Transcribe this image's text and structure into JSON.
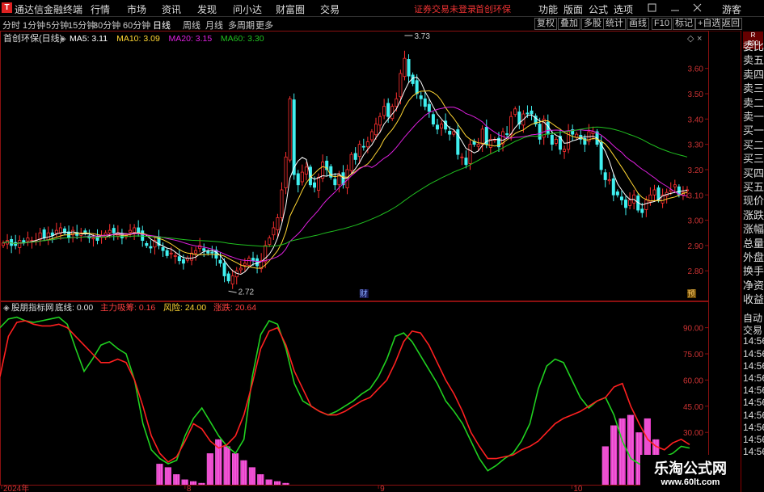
{
  "window": {
    "title": "通达信金融终端",
    "guest": "游客",
    "notice": "证券交易未登录",
    "stock_short": "首创环保"
  },
  "menu": [
    "行情",
    "市场",
    "资讯",
    "发现",
    "问小达",
    "财富圈",
    "交易"
  ],
  "menu_right": [
    "功能",
    "版面",
    "公式",
    "选项"
  ],
  "periods": [
    "分时",
    "1分钟",
    "5分钟",
    "15分钟",
    "30分钟",
    "60分钟",
    "日线",
    "周线",
    "月线",
    "多周期",
    "更多"
  ],
  "period_selected": "日线",
  "toolbar": [
    "复权",
    "叠加",
    "多股",
    "统计",
    "画线",
    "F10",
    "标记",
    "+自选",
    "返回"
  ],
  "right_panel": {
    "badge_top": "R",
    "badge_bottom": "500",
    "items": [
      "委比",
      "卖五",
      "卖四",
      "卖三",
      "卖二",
      "卖一",
      "买一",
      "买二",
      "买三",
      "买四",
      "买五",
      "现价",
      "涨跌",
      "涨幅",
      "总量",
      "外盘",
      "换手",
      "净资",
      "收益"
    ]
  },
  "right_panel_lower": [
    "自动",
    "交易",
    "14:56",
    "14:56",
    "14:56",
    "14:56",
    "14:56",
    "14:56",
    "14:56",
    "14:56",
    "14:56",
    "14:56"
  ],
  "watermark": {
    "line1": "乐淘公式网",
    "line2": "www.60lt.com"
  },
  "chart_data": [
    {
      "type": "candlestick",
      "title": "首创环保(日线)",
      "legend": [
        {
          "name": "MA5",
          "value": "3.11",
          "color": "#ffffff"
        },
        {
          "name": "MA10",
          "value": "3.09",
          "color": "#ffd633"
        },
        {
          "name": "MA20",
          "value": "3.15",
          "color": "#e020e0"
        },
        {
          "name": "MA60",
          "value": "3.30",
          "color": "#20c020"
        }
      ],
      "y_ticks": [
        "3.60",
        "3.50",
        "3.40",
        "3.30",
        "3.20",
        "3.10",
        "3.00",
        "2.90",
        "2.80"
      ],
      "ylim": [
        2.74,
        3.73
      ],
      "annotations": [
        {
          "text": "3.73",
          "index": 98,
          "value": 3.73
        },
        {
          "text": "2.72",
          "index": 55,
          "value": 2.72
        }
      ],
      "markers": [
        {
          "text": "财",
          "index": 88
        },
        {
          "text": "预",
          "index": 168
        }
      ],
      "close": [
        2.91,
        2.92,
        2.9,
        2.9,
        2.92,
        2.91,
        2.93,
        2.92,
        2.92,
        2.95,
        2.93,
        2.95,
        2.94,
        2.96,
        2.97,
        2.95,
        2.93,
        2.96,
        2.94,
        2.95,
        2.95,
        2.93,
        2.93,
        2.92,
        2.94,
        2.95,
        2.96,
        2.95,
        2.95,
        2.93,
        2.94,
        2.96,
        2.97,
        2.95,
        2.92,
        2.9,
        2.89,
        2.92,
        2.9,
        2.88,
        2.86,
        2.87,
        2.86,
        2.84,
        2.83,
        2.85,
        2.87,
        2.88,
        2.9,
        2.88,
        2.87,
        2.87,
        2.85,
        2.83,
        2.78,
        2.76,
        2.78,
        2.8,
        2.81,
        2.83,
        2.85,
        2.84,
        2.82,
        2.84,
        2.9,
        2.93,
        2.97,
        3.01,
        3.12,
        3.25,
        3.48,
        3.18,
        3.14,
        3.19,
        3.21,
        3.14,
        3.13,
        3.17,
        3.23,
        3.2,
        3.17,
        3.14,
        3.18,
        3.14,
        3.2,
        3.26,
        3.24,
        3.3,
        3.29,
        3.31,
        3.35,
        3.38,
        3.41,
        3.45,
        3.41,
        3.45,
        3.48,
        3.58,
        3.64,
        3.57,
        3.54,
        3.5,
        3.48,
        3.45,
        3.43,
        3.38,
        3.36,
        3.38,
        3.36,
        3.34,
        3.35,
        3.26,
        3.25,
        3.22,
        3.3,
        3.3,
        3.3,
        3.36,
        3.3,
        3.32,
        3.32,
        3.29,
        3.35,
        3.34,
        3.41,
        3.44,
        3.38,
        3.42,
        3.42,
        3.42,
        3.38,
        3.32,
        3.4,
        3.34,
        3.3,
        3.32,
        3.28,
        3.28,
        3.35,
        3.34,
        3.34,
        3.32,
        3.3,
        3.35,
        3.35,
        3.3,
        3.2,
        3.16,
        3.16,
        3.1,
        3.1,
        3.08,
        3.05,
        3.08,
        3.1,
        3.04,
        3.03,
        3.08,
        3.1,
        3.12,
        3.08,
        3.1,
        3.11,
        3.12,
        3.14,
        3.1,
        3.11,
        3.12
      ]
    },
    {
      "type": "line",
      "title": "股朋指标网",
      "legend": [
        {
          "name": "底线",
          "value": "0.00",
          "color": "#e0e0e0"
        },
        {
          "name": "主力吸筹",
          "value": "0.16",
          "color": "#ff4040"
        },
        {
          "name": "风险",
          "value": "24.00",
          "color": "#ffd633"
        },
        {
          "name": "涨跌",
          "value": "20.64",
          "color": "#ff4040"
        }
      ],
      "y_ticks": [
        "90.00",
        "75.00",
        "60.00",
        "45.00",
        "30.00",
        "15.00"
      ],
      "ylim": [
        0,
        100
      ],
      "x_ticks": [
        {
          "label": "2024年",
          "index": 0
        },
        {
          "label": "8",
          "index": 22
        },
        {
          "label": "9",
          "index": 45
        },
        {
          "label": "10",
          "index": 68
        },
        {
          "label": "11",
          "index": 90
        },
        {
          "label": "12",
          "index": 112
        },
        {
          "label": "1",
          "index": 135
        }
      ],
      "series": [
        {
          "name": "涨跌",
          "color": "#ff2020",
          "values": [
            62,
            85,
            93,
            94,
            92,
            91,
            91,
            92,
            90,
            85,
            80,
            75,
            70,
            70,
            72,
            70,
            60,
            45,
            28,
            18,
            13,
            16,
            25,
            35,
            32,
            25,
            21,
            23,
            28,
            40,
            58,
            78,
            88,
            90,
            80,
            65,
            55,
            45,
            42,
            40,
            40,
            42,
            45,
            48,
            50,
            55,
            60,
            70,
            82,
            88,
            87,
            80,
            70,
            60,
            52,
            42,
            30,
            22,
            15,
            15,
            16,
            17,
            20,
            22,
            25,
            30,
            35,
            38,
            40,
            42,
            45,
            48,
            50,
            56,
            58,
            45,
            35,
            26,
            22,
            20,
            24,
            26,
            23
          ]
        },
        {
          "name": "主力吸筹",
          "color": "#20d020",
          "values": [
            90,
            95,
            96,
            94,
            93,
            94,
            95,
            96,
            92,
            78,
            65,
            72,
            80,
            82,
            78,
            75,
            60,
            35,
            20,
            15,
            12,
            14,
            28,
            38,
            44,
            36,
            28,
            22,
            18,
            26,
            62,
            86,
            94,
            92,
            78,
            58,
            48,
            45,
            42,
            40,
            42,
            45,
            48,
            52,
            55,
            62,
            72,
            85,
            87,
            82,
            74,
            66,
            58,
            48,
            42,
            35,
            25,
            15,
            8,
            11,
            15,
            18,
            25,
            35,
            55,
            68,
            72,
            70,
            60,
            50,
            44,
            48,
            50,
            40,
            25,
            15,
            12,
            10,
            12,
            16,
            18,
            22,
            21
          ]
        },
        {
          "name": "吸筹柱",
          "color": "#ff44dd",
          "values": [
            0,
            0,
            0,
            0,
            0,
            0,
            0,
            0,
            0,
            0,
            0,
            0,
            0,
            0,
            0,
            0,
            0,
            0,
            0,
            12,
            10,
            6,
            3,
            2,
            1,
            18,
            26,
            22,
            18,
            14,
            10,
            6,
            3,
            2,
            1,
            0,
            0,
            0,
            0,
            0,
            0,
            0,
            0,
            0,
            0,
            0,
            0,
            0,
            0,
            0,
            0,
            0,
            0,
            0,
            0,
            0,
            0,
            0,
            0,
            0,
            0,
            0,
            0,
            0,
            0,
            0,
            0,
            0,
            0,
            0,
            0,
            0,
            22,
            34,
            38,
            40,
            30,
            38,
            26,
            10,
            0,
            0,
            0
          ]
        }
      ]
    }
  ]
}
